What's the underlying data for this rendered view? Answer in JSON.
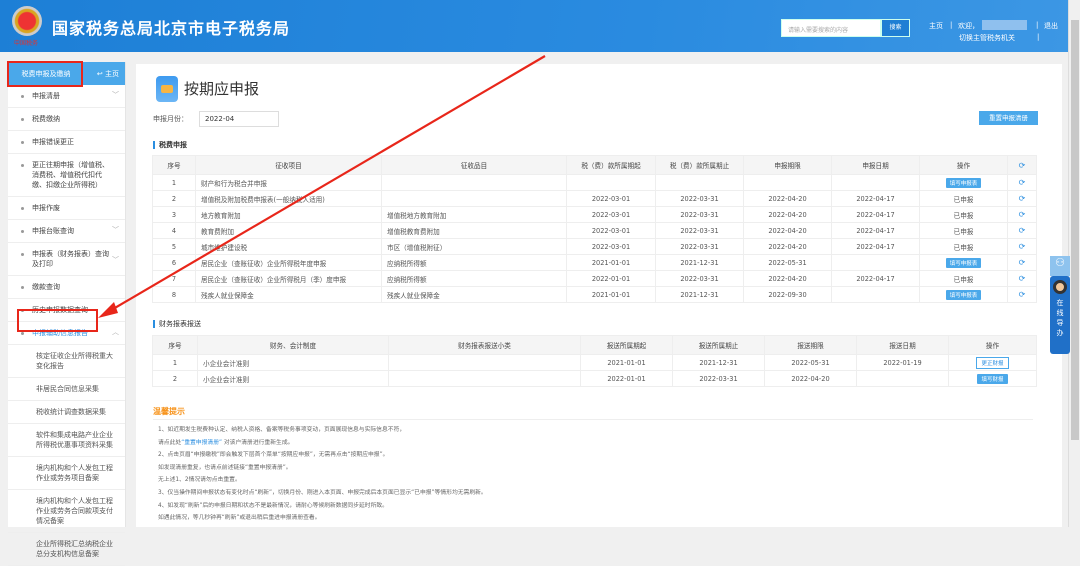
{
  "header": {
    "title": "国家税务总局北京市电子税务局",
    "emblem_text": "中国税务",
    "search_placeholder": "请输入需要搜索的内容",
    "search_button": "搜索",
    "home": "主页",
    "welcome": "欢迎，",
    "logout": "退出",
    "switch_office": "切换主管税务机关",
    "sep": "|"
  },
  "sidebar": {
    "top_button": "税费申报及缴纳",
    "home_link": "主页",
    "items": [
      "申报清册",
      "税费缴纳",
      "申报错误更正",
      "更正往期申报（增值税、消费税、增值税代扣代缴、扣缴企业所得税）",
      "申报作废",
      "申报台账查询",
      "申报表（财务报表）查询及打印",
      "缴款查询",
      "历史申报数据查询",
      "申报辅助信息报告"
    ],
    "subitems": [
      "核定征收企业所得税重大变化报告",
      "非居民合同信息采集",
      "税收统计调查数据采集",
      "软件和集成电路产业企业所得税优惠事项资料采集",
      "境内机构和个人发包工程作业或劳务项目备案",
      "境内机构和个人发包工程作业或劳务合同款项支付情况备案",
      "企业所得税汇总纳税企业总分支机构信息备案"
    ]
  },
  "main": {
    "title": "按期应申报",
    "month_label": "申报月份：",
    "month_value": "2022-04",
    "reset_button": "重置申报清册",
    "section1": "税费申报",
    "table1_headers": [
      "序号",
      "征收项目",
      "征收品目",
      "税（费）款所属期起",
      "税（费）款所属期止",
      "申报期限",
      "申报日期",
      "操作"
    ],
    "table1_rows": [
      [
        "1",
        "财产和行为税合并申报",
        "",
        "",
        "",
        "",
        "",
        "填写申报表"
      ],
      [
        "2",
        "增值税及附加税费申报表(一般纳税人适用)",
        "",
        "2022-03-01",
        "2022-03-31",
        "2022-04-20",
        "2022-04-17",
        "已申报"
      ],
      [
        "3",
        "地方教育附加",
        "增值税地方教育附加",
        "2022-03-01",
        "2022-03-31",
        "2022-04-20",
        "2022-04-17",
        "已申报"
      ],
      [
        "4",
        "教育费附加",
        "增值税教育费附加",
        "2022-03-01",
        "2022-03-31",
        "2022-04-20",
        "2022-04-17",
        "已申报"
      ],
      [
        "5",
        "城市维护建设税",
        "市区（增值税附征）",
        "2022-03-01",
        "2022-03-31",
        "2022-04-20",
        "2022-04-17",
        "已申报"
      ],
      [
        "6",
        "居民企业（查账征收）企业所得税年度申报",
        "应纳税所得额",
        "2021-01-01",
        "2021-12-31",
        "2022-05-31",
        "",
        "填写申报表"
      ],
      [
        "7",
        "居民企业（查账征收）企业所得税月（季）度申报",
        "应纳税所得额",
        "2022-01-01",
        "2022-03-31",
        "2022-04-20",
        "2022-04-17",
        "已申报"
      ],
      [
        "8",
        "残疾人就业保障金",
        "残疾人就业保障金",
        "2021-01-01",
        "2021-12-31",
        "2022-09-30",
        "",
        "填写申报表"
      ]
    ],
    "section2": "财务报表报送",
    "table2_headers": [
      "序号",
      "财务、会计制度",
      "财务报表报送小类",
      "报送所属期起",
      "报送所属期止",
      "报送期限",
      "报送日期",
      "操作"
    ],
    "table2_rows": [
      [
        "1",
        "小企业会计准则",
        "",
        "2021-01-01",
        "2021-12-31",
        "2022-05-31",
        "2022-01-19",
        "更正财报"
      ],
      [
        "2",
        "小企业会计准则",
        "",
        "2022-01-01",
        "2022-03-31",
        "2022-04-20",
        "",
        "填写财报"
      ]
    ],
    "tips_title": "温馨提示",
    "tips": [
      "1、如近期发生税费种认定、纳税人资格、备案等税务事项变动，页面展现信息与实际信息不符，",
      "请点此处",
      "“重置申报清册”",
      "对该户清册进行重新生成。",
      "2、点击页眉“申报缴税”即会触发下层首个菜单“按期应申报”，无需再点击“按期应申报”。",
      "如发现清册重复，也请点前述链接“重置申报清册”。",
      "无上述1、2情况请勿点击重置。",
      "3、仅当操作期间申报状态有变化时点“刷新”，切换月份、刚进入本页面、申报完成后本页面已显示“已申报”等情形均无需刷新。",
      "4、如发现“刷新”后的申报日期和状态不是最新情况，请耐心等候刷新数据同步延时所致。",
      "如遇此情况，等几秒钟再“刷新”或退出稍后重进申报清册查看。"
    ]
  },
  "float": {
    "label": "在线导办"
  },
  "colors": {
    "header": "#1d7fd6",
    "accent": "#4aa8ea",
    "annotation": "#e8261a",
    "tips": "#f7941d"
  }
}
